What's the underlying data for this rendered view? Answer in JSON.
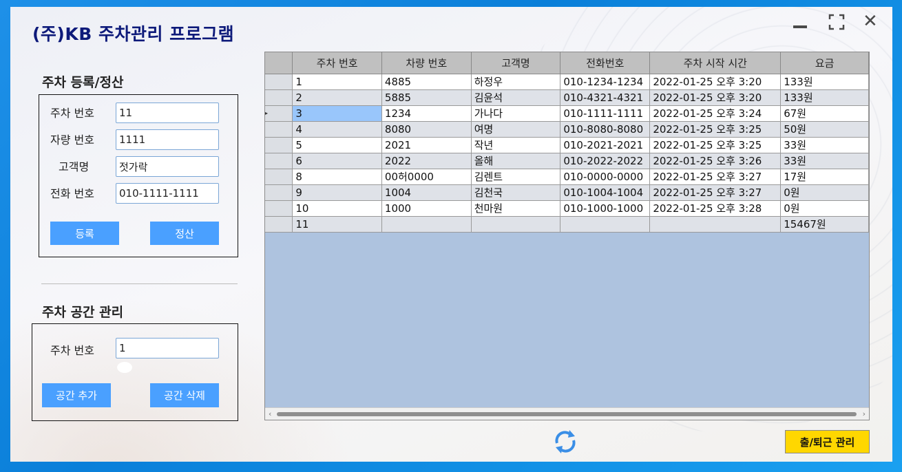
{
  "app": {
    "title": "(주)KB 주차관리 프로그램"
  },
  "register": {
    "title": "주차 등록/정산",
    "labels": {
      "slot": "주차 번호",
      "car": "자량 번호",
      "customer": "고객명",
      "phone": "전화 번호"
    },
    "values": {
      "slot": "11",
      "car": "1111",
      "customer": "젓가락",
      "phone": "010-1111-1111"
    },
    "buttons": {
      "register": "등록",
      "settle": "정산"
    }
  },
  "space": {
    "title": "주차 공간 관리",
    "labels": {
      "slot": "주차 번호"
    },
    "values": {
      "slot": "1"
    },
    "buttons": {
      "add": "공간 추가",
      "delete": "공간 삭제"
    }
  },
  "grid": {
    "columns": [
      "주차 번호",
      "차량 번호",
      "고객명",
      "전화번호",
      "주차 시작 시간",
      "요금"
    ],
    "rows": [
      [
        "1",
        "4885",
        "하정우",
        "010-1234-1234",
        "2022-01-25 오후 3:20",
        "133원"
      ],
      [
        "2",
        "5885",
        "김윤석",
        "010-4321-4321",
        "2022-01-25 오후 3:20",
        "133원"
      ],
      [
        "3",
        "1234",
        "가나다",
        "010-1111-1111",
        "2022-01-25 오후 3:24",
        "67원"
      ],
      [
        "4",
        "8080",
        "여명",
        "010-8080-8080",
        "2022-01-25 오후 3:25",
        "50원"
      ],
      [
        "5",
        "2021",
        "작년",
        "010-2021-2021",
        "2022-01-25 오후 3:25",
        "33원"
      ],
      [
        "6",
        "2022",
        "올해",
        "010-2022-2022",
        "2022-01-25 오후 3:26",
        "33원"
      ],
      [
        "8",
        "00허0000",
        "김렌트",
        "010-0000-0000",
        "2022-01-25 오후 3:27",
        "17원"
      ],
      [
        "9",
        "1004",
        "김천국",
        "010-1004-1004",
        "2022-01-25 오후 3:27",
        "0원"
      ],
      [
        "10",
        "1000",
        "천마원",
        "010-1000-1000",
        "2022-01-25 오후 3:28",
        "0원"
      ],
      [
        "11",
        "",
        "",
        "",
        "",
        "15467원"
      ]
    ],
    "selected_row": 2
  },
  "footer": {
    "commute_label": "출/퇴근 관리"
  },
  "icons": {
    "refresh": "refresh-icon",
    "minimize": "minimize-icon",
    "maximize": "maximize-icon",
    "close": "close-icon"
  },
  "colors": {
    "accent": "#4aa0ff",
    "title": "#0d1a7a",
    "commute": "#ffd700",
    "grid_bg": "#aec3df"
  }
}
